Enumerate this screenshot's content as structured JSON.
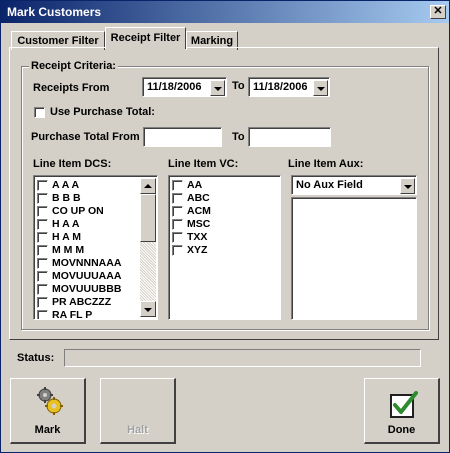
{
  "window": {
    "title": "Mark Customers",
    "close_glyph": "✕"
  },
  "tabs": [
    {
      "label": "Customer Filter",
      "active": false
    },
    {
      "label": "Receipt Filter",
      "active": true
    },
    {
      "label": "Marking",
      "active": false
    }
  ],
  "receipt_criteria": {
    "group_label": "Receipt Criteria:",
    "receipts_from_label": "Receipts From",
    "from_date": "11/18/2006",
    "to_label": "To",
    "to_date": "11/18/2006",
    "use_purchase_total_label": "Use Purchase Total:",
    "use_purchase_total_checked": false,
    "purchase_total_from_label": "Purchase Total From",
    "purchase_total_from_value": "",
    "purchase_total_to_label": "To",
    "purchase_total_to_value": ""
  },
  "line_item_dcs": {
    "label": "Line Item DCS:",
    "items": [
      "A  A  A",
      "B  B  B",
      "CO UP ON",
      "H  A  A",
      "H  A  M",
      "M  M  M",
      "MOVNNNAAA",
      "MOVUUUAAA",
      "MOVUUUBBB",
      "PR ABCZZZ",
      "RA FL P"
    ]
  },
  "line_item_vc": {
    "label": "Line Item VC:",
    "items": [
      "AA",
      "ABC",
      "ACM",
      "MSC",
      "TXX",
      "XYZ"
    ]
  },
  "line_item_aux": {
    "label": "Line Item Aux:",
    "selected": "No Aux Field"
  },
  "status": {
    "label": "Status:",
    "value": ""
  },
  "buttons": {
    "mark": "Mark",
    "halt": "Halt",
    "done": "Done"
  },
  "colors": {
    "title_bar": "#0a246a",
    "face": "#d4d0c8",
    "done_check": "#2e8b2e"
  },
  "icons": {
    "mark": "gears-icon",
    "done": "checkmark-icon"
  }
}
